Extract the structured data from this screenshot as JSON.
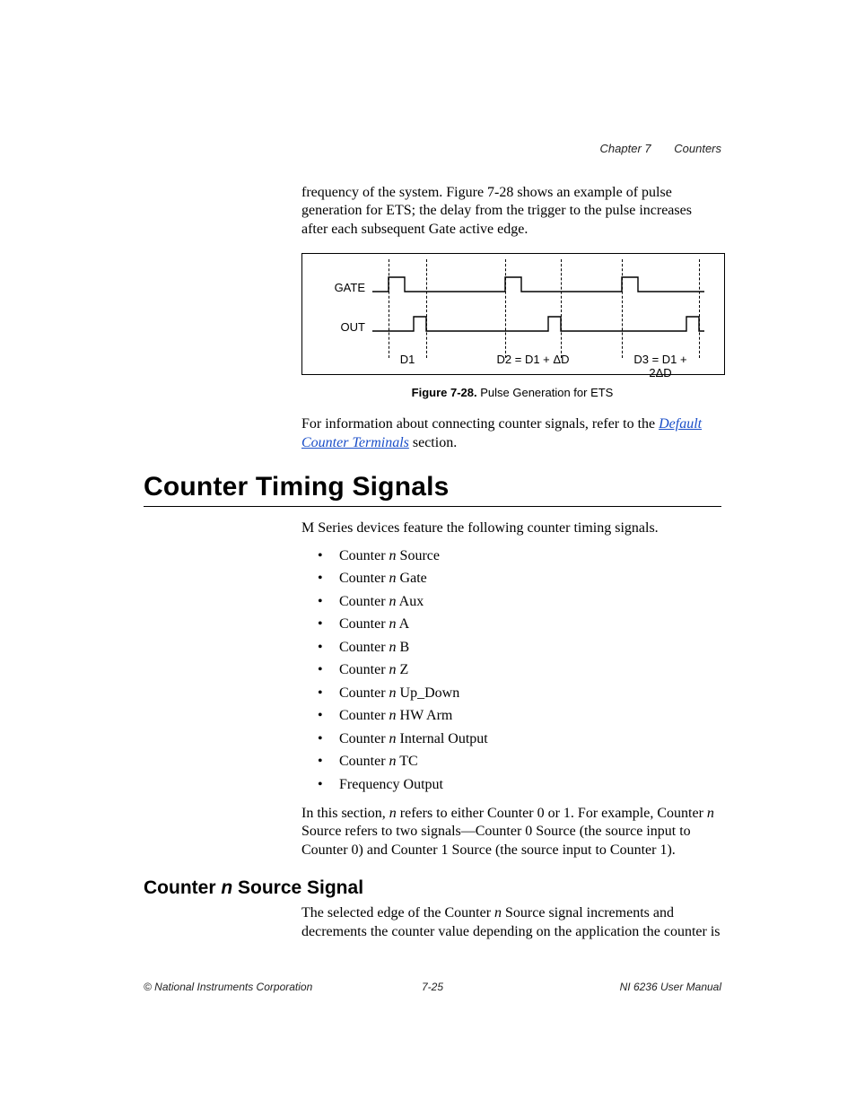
{
  "header": {
    "chapter": "Chapter 7",
    "title": "Counters"
  },
  "intro_para": "frequency of the system. Figure 7-28 shows an example of pulse generation for ETS; the delay from the trigger to the pulse increases after each subsequent Gate active edge.",
  "figure": {
    "gate_label": "GATE",
    "out_label": "OUT",
    "ann_d1": "D1",
    "ann_d2": "D2 = D1 + ΔD",
    "ann_d3": "D3 = D1 + 2ΔD",
    "caption_bold": "Figure 7-28.",
    "caption_rest": "  Pulse Generation for ETS"
  },
  "para_link_pre": "For information about connecting counter signals, refer to the ",
  "para_link_text": "Default Counter Terminals",
  "para_link_post": " section.",
  "h1": "Counter Timing Signals",
  "para_after_h1": "M Series devices feature the following counter timing signals.",
  "signals": [
    {
      "pre": "Counter ",
      "post": " Source"
    },
    {
      "pre": "Counter ",
      "post": " Gate"
    },
    {
      "pre": "Counter ",
      "post": " Aux"
    },
    {
      "pre": "Counter ",
      "post": " A"
    },
    {
      "pre": "Counter ",
      "post": " B"
    },
    {
      "pre": "Counter ",
      "post": " Z"
    },
    {
      "pre": "Counter ",
      "post": " Up_Down"
    },
    {
      "pre": "Counter ",
      "post": " HW Arm"
    },
    {
      "pre": "Counter ",
      "post": " Internal Output"
    },
    {
      "pre": "Counter ",
      "post": " TC"
    },
    {
      "pre": "Frequency Output",
      "post": ""
    }
  ],
  "n_glyph": "n",
  "para_explain_1": "In this section, ",
  "para_explain_2": " refers to either Counter 0 or 1. For example, Counter ",
  "para_explain_3": " Source refers to two signals—Counter 0 Source (the source input to Counter 0) and Counter 1 Source (the source input to Counter 1).",
  "h2_pre": "Counter ",
  "h2_post": " Source Signal",
  "para_h2_1": "The selected edge of the Counter ",
  "para_h2_2": " Source signal increments and decrements the counter value depending on the application the counter is",
  "footer": {
    "left": "© National Instruments Corporation",
    "center": "7-25",
    "right": "NI 6236 User Manual"
  }
}
